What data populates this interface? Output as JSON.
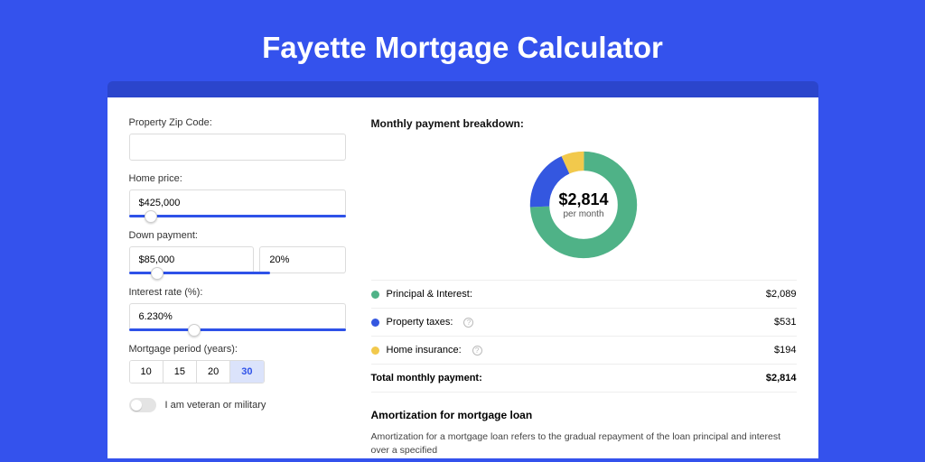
{
  "pageTitle": "Fayette Mortgage Calculator",
  "form": {
    "zip": {
      "label": "Property Zip Code:",
      "value": ""
    },
    "price": {
      "label": "Home price:",
      "value": "$425,000",
      "sliderPct": 10
    },
    "down": {
      "label": "Down payment:",
      "amount": "$85,000",
      "pct": "20%",
      "sliderPct": 20
    },
    "rate": {
      "label": "Interest rate (%):",
      "value": "6.230%",
      "sliderPct": 30
    },
    "period": {
      "label": "Mortgage period (years):",
      "options": [
        "10",
        "15",
        "20",
        "30"
      ],
      "active": "30"
    },
    "vet": {
      "label": "I am veteran or military"
    }
  },
  "breakdown": {
    "heading": "Monthly payment breakdown:",
    "centerAmount": "$2,814",
    "centerSub": "per month",
    "items": [
      {
        "label": "Principal & Interest:",
        "value": "$2,089",
        "color": "#4fb287",
        "help": false
      },
      {
        "label": "Property taxes:",
        "value": "$531",
        "color": "#3457e0",
        "help": true
      },
      {
        "label": "Home insurance:",
        "value": "$194",
        "color": "#f2c94c",
        "help": true
      }
    ],
    "total": {
      "label": "Total monthly payment:",
      "value": "$2,814"
    }
  },
  "amort": {
    "heading": "Amortization for mortgage loan",
    "body": "Amortization for a mortgage loan refers to the gradual repayment of the loan principal and interest over a specified"
  },
  "chart_data": {
    "type": "pie",
    "title": "Monthly payment breakdown",
    "categories": [
      "Principal & Interest",
      "Property taxes",
      "Home insurance"
    ],
    "values": [
      2089,
      531,
      194
    ],
    "total": 2814,
    "colors": [
      "#4fb287",
      "#3457e0",
      "#f2c94c"
    ]
  }
}
